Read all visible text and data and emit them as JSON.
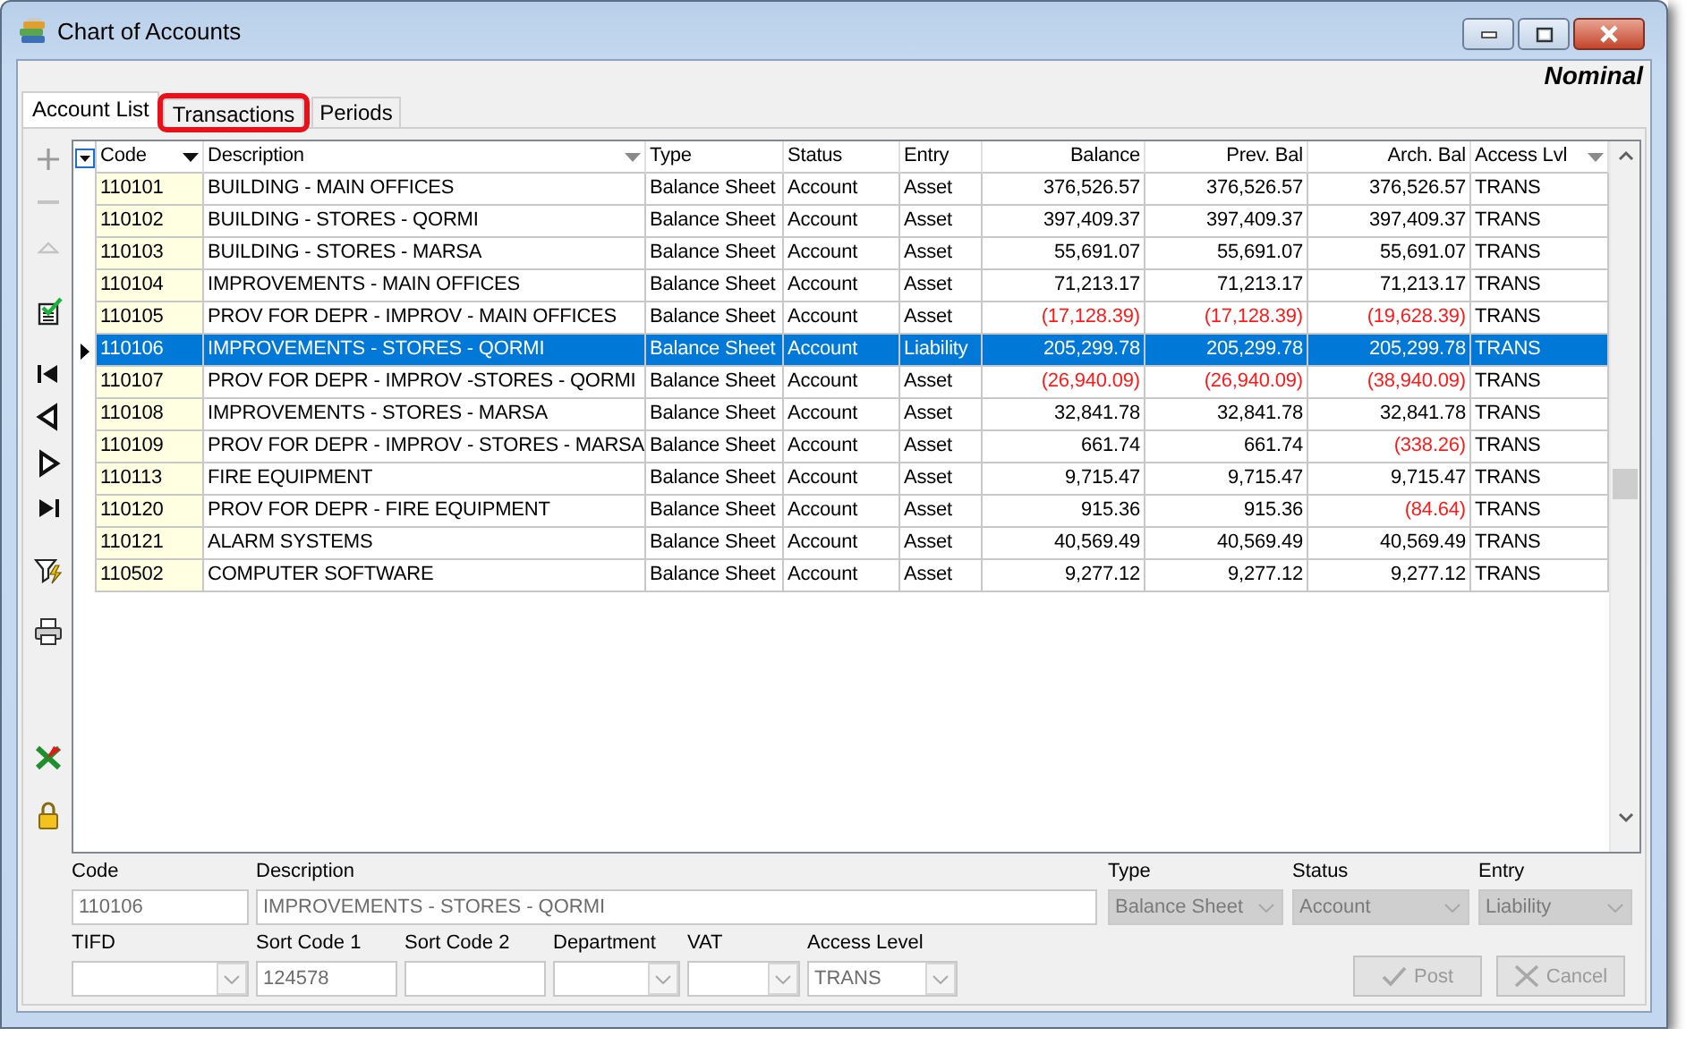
{
  "window": {
    "title": "Chart of Accounts"
  },
  "module": "Nominal",
  "tabs": [
    {
      "label": "Account List",
      "selected": true,
      "highlighted": false
    },
    {
      "label": "Transactions",
      "selected": false,
      "highlighted": true
    },
    {
      "label": "Periods",
      "selected": false,
      "highlighted": false
    }
  ],
  "table": {
    "columns": [
      {
        "label": "Code",
        "kind": "text",
        "filter_button": true,
        "filter_active": true
      },
      {
        "label": "Description",
        "kind": "text",
        "filter_button": true,
        "filter_active": false
      },
      {
        "label": "Type",
        "kind": "text"
      },
      {
        "label": "Status",
        "kind": "text"
      },
      {
        "label": "Entry",
        "kind": "text"
      },
      {
        "label": "Balance",
        "kind": "amount"
      },
      {
        "label": "Prev. Bal",
        "kind": "amount"
      },
      {
        "label": "Arch. Bal",
        "kind": "amount"
      },
      {
        "label": "Access Lvl",
        "kind": "text",
        "filter_button": true,
        "filter_active": false
      }
    ],
    "rows": [
      {
        "selected": false,
        "cells": [
          "110101",
          "BUILDING - MAIN OFFICES",
          "Balance Sheet",
          "Account",
          "Asset",
          {
            "value": "376,526.57",
            "negative": false
          },
          {
            "value": "376,526.57",
            "negative": false
          },
          {
            "value": "376,526.57",
            "negative": false
          },
          "TRANS"
        ]
      },
      {
        "selected": false,
        "cells": [
          "110102",
          "BUILDING - STORES - QORMI",
          "Balance Sheet",
          "Account",
          "Asset",
          {
            "value": "397,409.37",
            "negative": false
          },
          {
            "value": "397,409.37",
            "negative": false
          },
          {
            "value": "397,409.37",
            "negative": false
          },
          "TRANS"
        ]
      },
      {
        "selected": false,
        "cells": [
          "110103",
          "BUILDING - STORES - MARSA",
          "Balance Sheet",
          "Account",
          "Asset",
          {
            "value": "55,691.07",
            "negative": false
          },
          {
            "value": "55,691.07",
            "negative": false
          },
          {
            "value": "55,691.07",
            "negative": false
          },
          "TRANS"
        ]
      },
      {
        "selected": false,
        "cells": [
          "110104",
          "IMPROVEMENTS - MAIN OFFICES",
          "Balance Sheet",
          "Account",
          "Asset",
          {
            "value": "71,213.17",
            "negative": false
          },
          {
            "value": "71,213.17",
            "negative": false
          },
          {
            "value": "71,213.17",
            "negative": false
          },
          "TRANS"
        ]
      },
      {
        "selected": false,
        "cells": [
          "110105",
          "PROV FOR DEPR - IMPROV - MAIN OFFICES",
          "Balance Sheet",
          "Account",
          "Asset",
          {
            "value": "(17,128.39)",
            "negative": true
          },
          {
            "value": "(17,128.39)",
            "negative": true
          },
          {
            "value": "(19,628.39)",
            "negative": true
          },
          "TRANS"
        ]
      },
      {
        "selected": true,
        "cells": [
          "110106",
          "IMPROVEMENTS - STORES - QORMI",
          "Balance Sheet",
          "Account",
          "Liability",
          {
            "value": "205,299.78",
            "negative": false
          },
          {
            "value": "205,299.78",
            "negative": false
          },
          {
            "value": "205,299.78",
            "negative": false
          },
          "TRANS"
        ]
      },
      {
        "selected": false,
        "cells": [
          "110107",
          "PROV FOR DEPR - IMPROV -STORES - QORMI",
          "Balance Sheet",
          "Account",
          "Asset",
          {
            "value": "(26,940.09)",
            "negative": true
          },
          {
            "value": "(26,940.09)",
            "negative": true
          },
          {
            "value": "(38,940.09)",
            "negative": true
          },
          "TRANS"
        ]
      },
      {
        "selected": false,
        "cells": [
          "110108",
          "IMPROVEMENTS - STORES - MARSA",
          "Balance Sheet",
          "Account",
          "Asset",
          {
            "value": "32,841.78",
            "negative": false
          },
          {
            "value": "32,841.78",
            "negative": false
          },
          {
            "value": "32,841.78",
            "negative": false
          },
          "TRANS"
        ]
      },
      {
        "selected": false,
        "cells": [
          "110109",
          "PROV FOR DEPR - IMPROV - STORES - MARSA",
          "Balance Sheet",
          "Account",
          "Asset",
          {
            "value": "661.74",
            "negative": false
          },
          {
            "value": "661.74",
            "negative": false
          },
          {
            "value": "(338.26)",
            "negative": true
          },
          "TRANS"
        ]
      },
      {
        "selected": false,
        "cells": [
          "110113",
          "FIRE EQUIPMENT",
          "Balance Sheet",
          "Account",
          "Asset",
          {
            "value": "9,715.47",
            "negative": false
          },
          {
            "value": "9,715.47",
            "negative": false
          },
          {
            "value": "9,715.47",
            "negative": false
          },
          "TRANS"
        ]
      },
      {
        "selected": false,
        "cells": [
          "110120",
          "PROV FOR DEPR - FIRE EQUIPMENT",
          "Balance Sheet",
          "Account",
          "Asset",
          {
            "value": "915.36",
            "negative": false
          },
          {
            "value": "915.36",
            "negative": false
          },
          {
            "value": "(84.64)",
            "negative": true
          },
          "TRANS"
        ]
      },
      {
        "selected": false,
        "cells": [
          "110121",
          "ALARM SYSTEMS",
          "Balance Sheet",
          "Account",
          "Asset",
          {
            "value": "40,569.49",
            "negative": false
          },
          {
            "value": "40,569.49",
            "negative": false
          },
          {
            "value": "40,569.49",
            "negative": false
          },
          "TRANS"
        ]
      },
      {
        "selected": false,
        "cells": [
          "110502",
          "COMPUTER SOFTWARE",
          "Balance Sheet",
          "Account",
          "Asset",
          {
            "value": "9,277.12",
            "negative": false
          },
          {
            "value": "9,277.12",
            "negative": false
          },
          {
            "value": "9,277.12",
            "negative": false
          },
          "TRANS"
        ]
      }
    ]
  },
  "form": {
    "lines": [
      [
        {
          "label": "Code",
          "kind": "text",
          "value": "110106",
          "disabled": false
        },
        {
          "label": "Description",
          "kind": "text",
          "value": "IMPROVEMENTS - STORES - QORMI",
          "disabled": false
        },
        {
          "label": "Type",
          "kind": "select",
          "value": "Balance Sheet",
          "disabled": true
        },
        {
          "label": "Status",
          "kind": "select",
          "value": "Account",
          "disabled": true
        },
        {
          "label": "Entry",
          "kind": "select",
          "value": "Liability",
          "disabled": true
        }
      ],
      [
        {
          "label": "TIFD",
          "kind": "select",
          "disabled": false
        },
        {
          "label": "Sort Code 1",
          "kind": "text",
          "value": "124578",
          "disabled": false
        },
        {
          "label": "Sort Code 2",
          "kind": "text",
          "disabled": false
        },
        {
          "label": "Department",
          "kind": "select",
          "disabled": false
        },
        {
          "label": "VAT",
          "kind": "select",
          "disabled": false
        },
        {
          "label": "Access Level",
          "kind": "select",
          "value": "TRANS",
          "disabled": false
        }
      ]
    ],
    "buttons": [
      {
        "label": "Post",
        "kind": "post",
        "disabled": true
      },
      {
        "label": "Cancel",
        "kind": "cancel",
        "disabled": true
      }
    ]
  }
}
